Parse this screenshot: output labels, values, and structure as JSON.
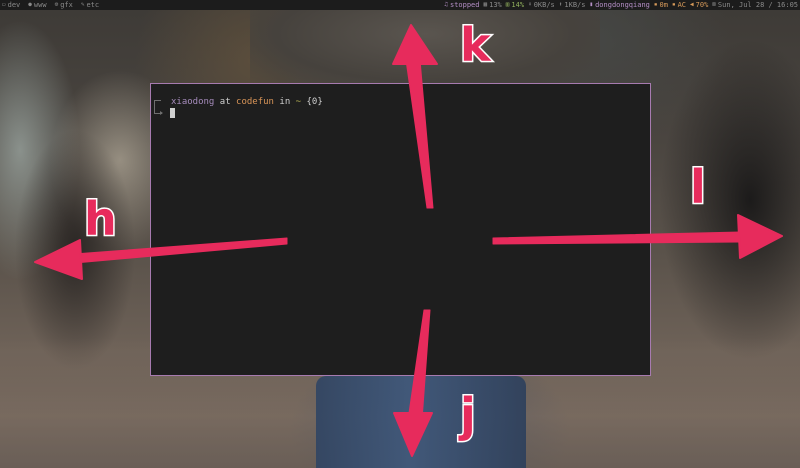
{
  "statusbar": {
    "workspaces": [
      {
        "icon": "terminal-icon",
        "glyph": "▭",
        "label": "dev"
      },
      {
        "icon": "user-icon",
        "glyph": "●",
        "label": "www"
      },
      {
        "icon": "gear-icon",
        "glyph": "⚙",
        "label": "gfx"
      },
      {
        "icon": "wrench-icon",
        "glyph": "✎",
        "label": "etc"
      }
    ],
    "music": {
      "glyph": "♫",
      "label": "stopped"
    },
    "cpu": {
      "glyph": "▦",
      "label": "13%"
    },
    "memory": {
      "glyph": "▥",
      "label": "14%"
    },
    "download": {
      "glyph": "⬇",
      "label": "0KB/s"
    },
    "upload": {
      "glyph": "⬆",
      "label": "1KB/s"
    },
    "wifi": {
      "glyph": "▮",
      "label": "dongdongqiang"
    },
    "battery_time": {
      "glyph": "▪",
      "label": "0m"
    },
    "power": {
      "glyph": "▪",
      "label": "AC"
    },
    "volume": {
      "glyph": "◀",
      "label": "70%"
    },
    "datetime": {
      "glyph": "⊠",
      "label": "Sun, Jul 28 / 16:05"
    }
  },
  "terminal": {
    "user": "xiaodong",
    "at": "at",
    "host": "codefun",
    "in": "in",
    "path": "~",
    "status": "{0}"
  },
  "overlay": {
    "letters": {
      "left": "h",
      "up": "k",
      "down": "j",
      "right": "l"
    },
    "arrow_color": "#e72b5c"
  },
  "colors": {
    "statusbar_text": "#8a8a8a",
    "statusbar_accent": "#b58fc7",
    "statusbar_green": "#8fae5c",
    "statusbar_orange": "#d79a5a",
    "terminal_bg": "#1e1e1e",
    "terminal_border": "#a77bb0",
    "user": "#a58bbb",
    "host": "#d99558",
    "path": "#b8b255"
  }
}
